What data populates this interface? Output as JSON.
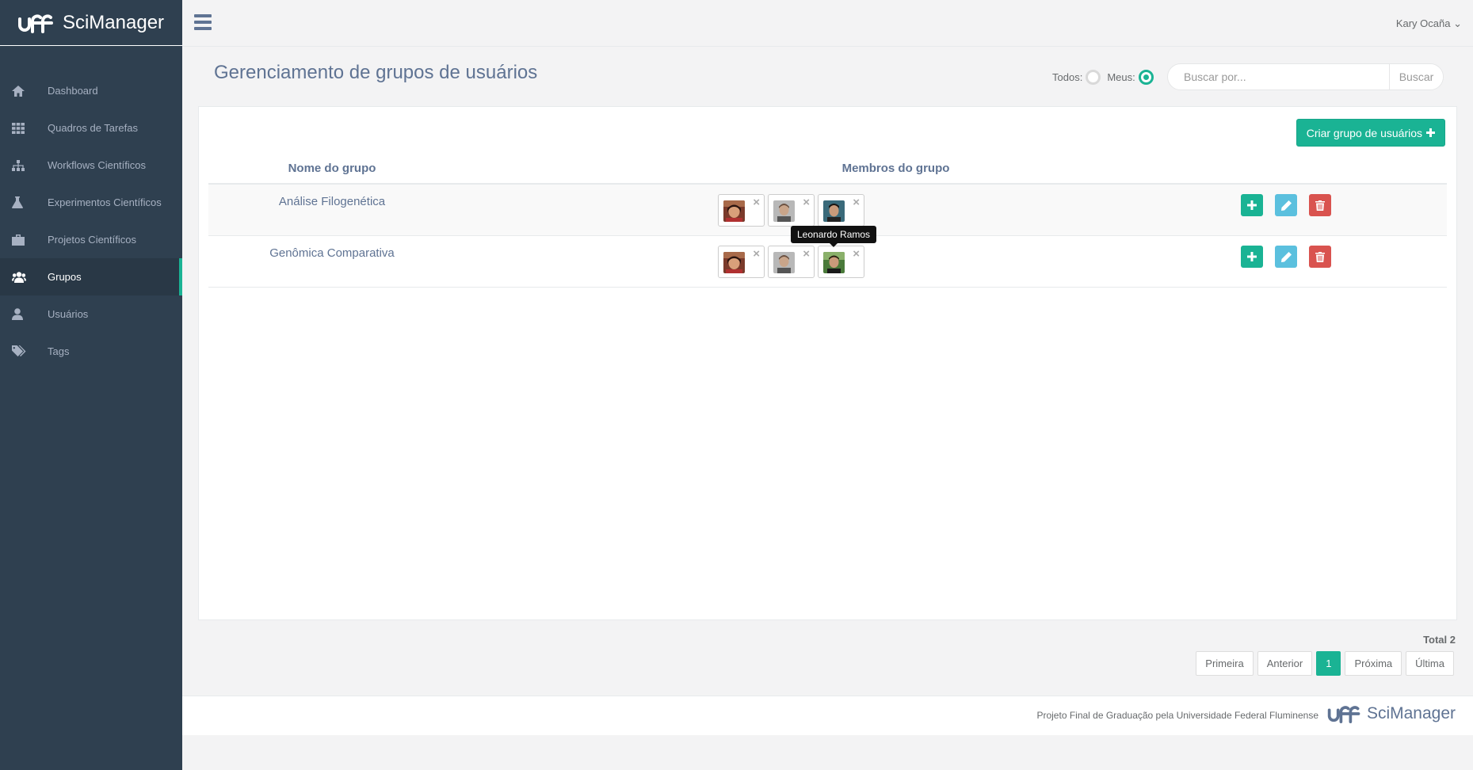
{
  "brand": {
    "name": "SciManager",
    "logo_text": "uff"
  },
  "sidebar": {
    "items": [
      {
        "label": "Dashboard",
        "icon": "home-icon"
      },
      {
        "label": "Quadros de Tarefas",
        "icon": "grid-icon"
      },
      {
        "label": "Workflows Científicos",
        "icon": "sitemap-icon"
      },
      {
        "label": "Experimentos Científicos",
        "icon": "flask-icon"
      },
      {
        "label": "Projetos Científicos",
        "icon": "briefcase-icon"
      },
      {
        "label": "Grupos",
        "icon": "users-icon",
        "active": true
      },
      {
        "label": "Usuários",
        "icon": "user-icon"
      },
      {
        "label": "Tags",
        "icon": "tags-icon"
      }
    ]
  },
  "topbar": {
    "user": "Kary Ocaña"
  },
  "page": {
    "title": "Gerenciamento de grupos de usuários",
    "filter_all": "Todos:",
    "filter_mine": "Meus:",
    "selected_filter": "Meus",
    "search_placeholder": "Buscar por...",
    "search_button": "Buscar",
    "create_button": "Criar grupo de usuários"
  },
  "table": {
    "headers": {
      "name": "Nome do grupo",
      "members": "Membros do grupo"
    },
    "rows": [
      {
        "name": "Análise Filogenética",
        "members": 3
      },
      {
        "name": "Genômica Comparativa",
        "members": 3
      }
    ],
    "tooltip": "Leonardo Ramos"
  },
  "pagination": {
    "total": "Total 2",
    "first": "Primeira",
    "prev": "Anterior",
    "current": "1",
    "next": "Próxima",
    "last": "Última"
  },
  "footer": {
    "text": "Projeto Final de Graduação pela Universidade Federal Fluminense",
    "brand": "SciManager"
  },
  "colors": {
    "accent": "#1ab394",
    "sidebar": "#2f4050",
    "info": "#5bc0de",
    "danger": "#d9534f"
  }
}
